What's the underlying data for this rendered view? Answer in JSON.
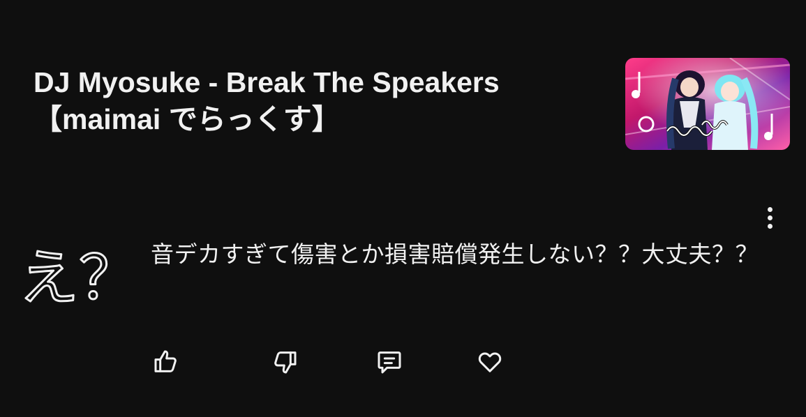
{
  "video": {
    "title": "DJ Myosuke - Break The Speakers【maimai でらっくす】",
    "thumbnail_icon": "video-thumbnail"
  },
  "comment": {
    "avatar_text": "え？",
    "text": "音デカすぎて傷害とか損害賠償発生しない？？大丈夫？？",
    "menu_icon": "more-vertical-icon"
  },
  "actions": {
    "like_icon": "thumbs-up-icon",
    "dislike_icon": "thumbs-down-icon",
    "reply_icon": "comment-icon",
    "heart_icon": "heart-icon"
  },
  "colors": {
    "background": "#0f0f0f",
    "text": "#f1f1f1"
  }
}
